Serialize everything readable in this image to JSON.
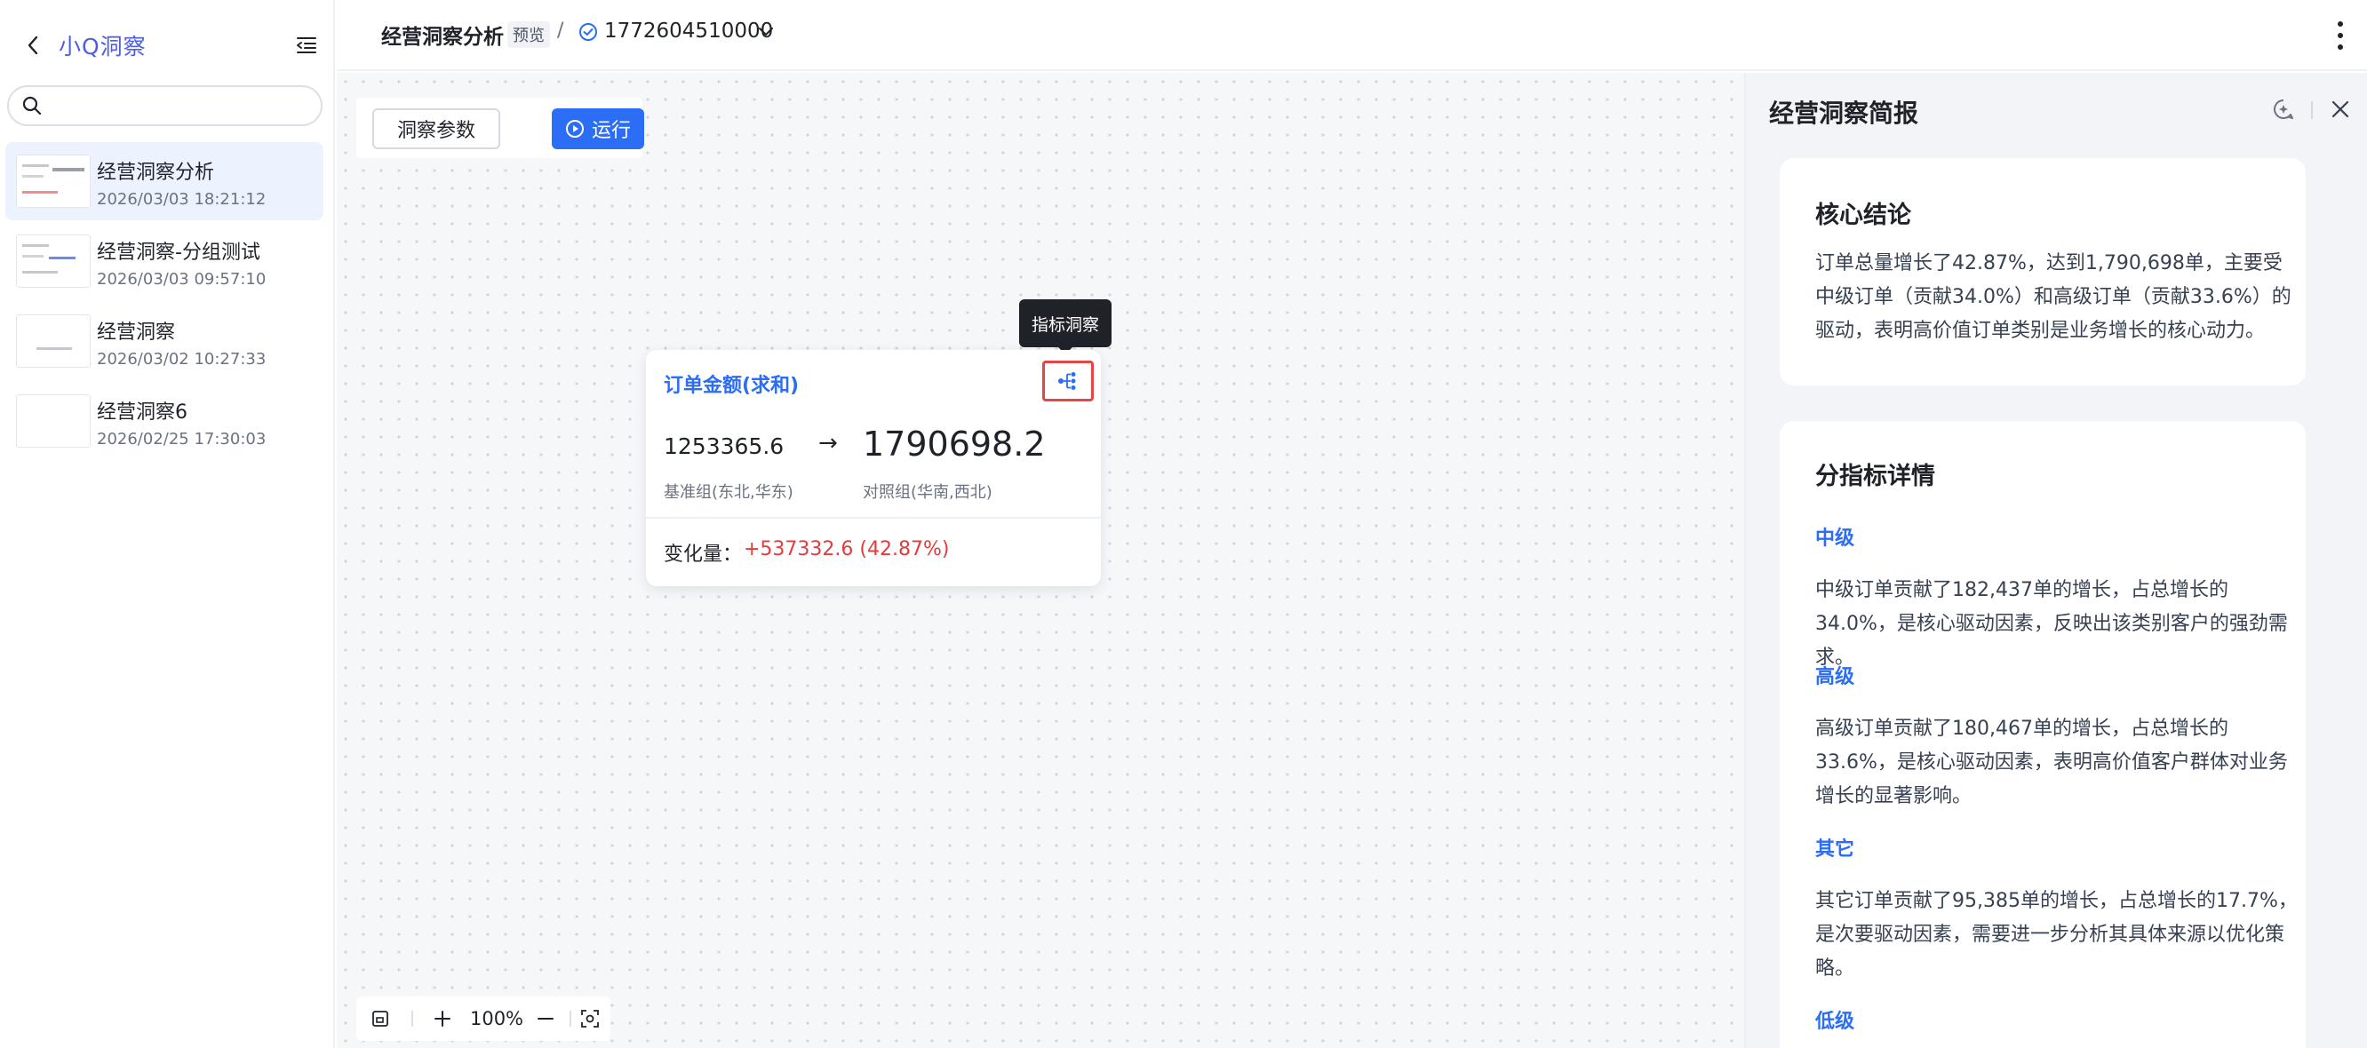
{
  "sidebar": {
    "brand": "小Q洞察",
    "search_placeholder": "",
    "history": [
      {
        "title": "经营洞察分析",
        "time": "2026/03/03 18:21:12"
      },
      {
        "title": "经营洞察-分组测试",
        "time": "2026/03/03 09:57:10"
      },
      {
        "title": "经营洞察",
        "time": "2026/03/02 10:27:33"
      },
      {
        "title": "经营洞察6",
        "time": "2026/02/25 17:30:03"
      }
    ]
  },
  "topbar": {
    "title": "经营洞察分析",
    "tag": "预览",
    "separator": "/",
    "version_id": "1772604510000"
  },
  "canvas": {
    "param_label": "洞察参数",
    "run_label": "运行",
    "card": {
      "title": "订单金额(求和)",
      "tooltip": "指标洞察",
      "base_value": "1253365.6",
      "arrow": "→",
      "compare_value": "1790698.2",
      "base_label": "基准组(东北,华东)",
      "compare_label": "对照组(华南,西北)",
      "change_label": "变化量：",
      "change_value": "+537332.6 (42.87%)"
    },
    "zoom": "100%"
  },
  "panel": {
    "title": "经营洞察简报",
    "core": {
      "heading": "核心结论",
      "text": "订单总量增长了42.87%，达到1,790,698单，主要受中级订单（贡献34.0%）和高级订单（贡献33.6%）的驱动，表明高价值订单类别是业务增长的核心动力。"
    },
    "detail": {
      "heading": "分指标详情",
      "items": [
        {
          "name": "中级",
          "text": "中级订单贡献了182,437单的增长，占总增长的34.0%，是核心驱动因素，反映出该类别客户的强劲需求。"
        },
        {
          "name": "高级",
          "text": "高级订单贡献了180,467单的增长，占总增长的33.6%，是核心驱动因素，表明高价值客户群体对业务增长的显著影响。"
        },
        {
          "name": "其它",
          "text": "其它订单贡献了95,385单的增长，占总增长的17.7%，是次要驱动因素，需要进一步分析其具体来源以优化策略。"
        },
        {
          "name": "低级",
          "text": ""
        }
      ]
    }
  },
  "colors": {
    "accent": "#2b6df5",
    "brand": "#4e5de6",
    "positive_change": "#e63b3b",
    "highlight_border": "#e64545"
  }
}
